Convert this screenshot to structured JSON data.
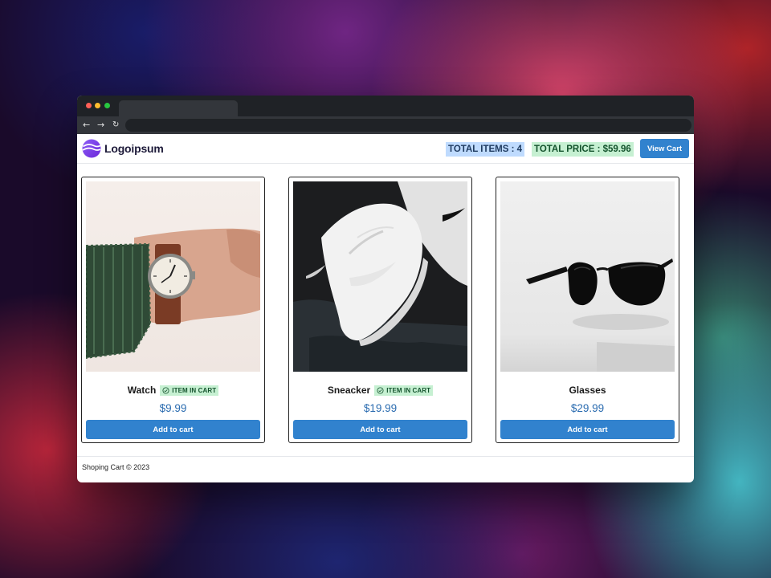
{
  "header": {
    "logo_text": "Logoipsum",
    "total_items": "TOTAL ITEMS : 4",
    "total_price": "TOTAL PRICE : $59.96",
    "view_cart_label": "View Cart"
  },
  "products": [
    {
      "name": "Watch",
      "price": "$9.99",
      "in_cart": true,
      "in_cart_label": "ITEM IN CART",
      "button_label": "Add to cart",
      "image": "watch-photo"
    },
    {
      "name": "Sneacker",
      "price": "$19.99",
      "in_cart": true,
      "in_cart_label": "ITEM IN CART",
      "button_label": "Add to cart",
      "image": "sneaker-photo"
    },
    {
      "name": "Glasses",
      "price": "$29.99",
      "in_cart": false,
      "button_label": "Add to cart",
      "image": "sunglasses-photo"
    }
  ],
  "footer": {
    "text": "Shoping Cart © 2023"
  },
  "colors": {
    "accent": "#3182ce",
    "items_badge_bg": "#bfdbfe",
    "price_badge_bg": "#c6f0d2",
    "price_text": "#2b6cb0"
  },
  "icons": [
    "back-arrow-icon",
    "forward-arrow-icon",
    "reload-icon",
    "logo-icon",
    "check-circle-icon"
  ]
}
